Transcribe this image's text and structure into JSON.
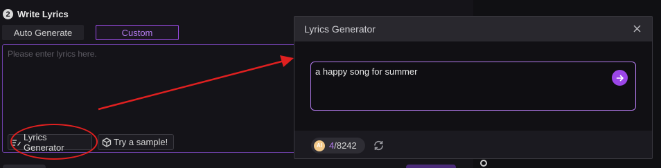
{
  "write_lyrics": {
    "step_number": "2",
    "title": "Write Lyrics",
    "tabs": [
      {
        "label": "Auto Generate",
        "active": false
      },
      {
        "label": "Custom",
        "active": true
      }
    ],
    "lyrics_placeholder": "Please enter lyrics here.",
    "tools": {
      "generator_label": "Lyrics Generator",
      "sample_label": "Try a sample!"
    }
  },
  "dialog": {
    "title": "Lyrics Generator",
    "prompt_value": "a happy song for summer",
    "quota": {
      "badge": "AI",
      "used": "4",
      "total": "/8242"
    }
  },
  "icons": {
    "close": "close-icon",
    "send": "arrow-right-icon",
    "refresh": "refresh-icon",
    "generator": "lyrics-edit-icon",
    "sample": "cube-icon"
  },
  "colors": {
    "accent": "#9b46e8",
    "accent_text": "#b57cf0",
    "annotation": "#e02020"
  }
}
